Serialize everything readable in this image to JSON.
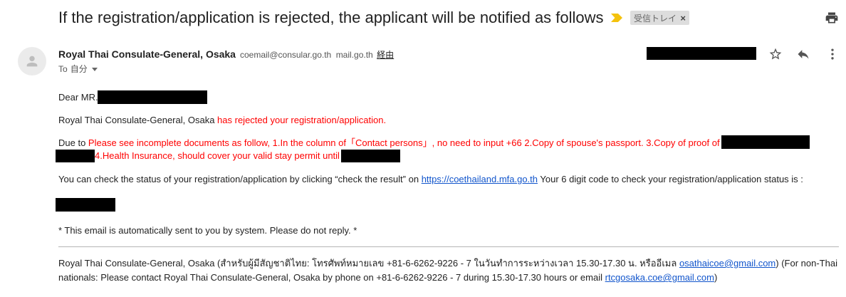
{
  "colors": {
    "text": "#222222",
    "highlight_red": "#ff0000",
    "link_blue": "#1155cc",
    "importance_yellow": "#f4c20d",
    "label_chip_bg": "#dddddd"
  },
  "icons": {
    "importance": "importance-marker-icon",
    "print": "print-icon",
    "avatar": "person-icon",
    "recipient_details": "chevron-down-icon",
    "star": "star-icon",
    "reply": "reply-icon",
    "more": "more-vert-icon"
  },
  "thread": {
    "subject": "If the registration/application is rejected, the applicant will be notified as follows",
    "labels": [
      {
        "name": "受信トレイ",
        "remove": "×"
      }
    ]
  },
  "message": {
    "sender": {
      "name": "Royal Thai Consulate-General, Osaka",
      "email": "coemail@consular.go.th",
      "via_domain": "mail.go.th",
      "via_label": "経由"
    },
    "recipients": {
      "to_label": "To",
      "to_value": "自分"
    },
    "body": {
      "greeting": "Dear MR.",
      "rejection_prefix": "Royal Thai Consulate-General, Osaka ",
      "rejection_text": "has rejected your registration/application.",
      "reason_prefix": "Due to ",
      "reason_line1": "Please see incomplete documents as follow, 1.In the column of「Contact persons」, no need to input +66 2.Copy of spouse's passport. 3.Copy of proof of",
      "reason_line2": "4.Health Insurance, should cover your valid stay permit until",
      "status_before_link": "You can check the status of your registration/application by clicking “check the result” on ",
      "status_link": "https://coethailand.mfa.go.th",
      "status_after_link": " Your 6 digit code to check your registration/application status is :",
      "auto_notice": "* This email is automatically sent to you by system. Please do not reply. *"
    },
    "footer": {
      "line1_text": "Royal Thai Consulate-General, Osaka (สำหรับผู้มีสัญชาติไทย: โทรศัพท์หมายเลข +81-6-6262-9226 - 7 ในวันทำการระหว่างเวลา 15.30-17.30 น. หรืออีเมล ",
      "line1_email": "osathaicoe@gmail.com",
      "line1_after": ") (For non-Thai",
      "line2_text": "nationals: Please contact Royal Thai Consulate-General, Osaka by phone on +81-6-6262-9226 - 7 during 15.30-17.30 hours or email ",
      "line2_email": "rtcgosaka.coe@gmail.com",
      "line2_after": ")"
    }
  }
}
